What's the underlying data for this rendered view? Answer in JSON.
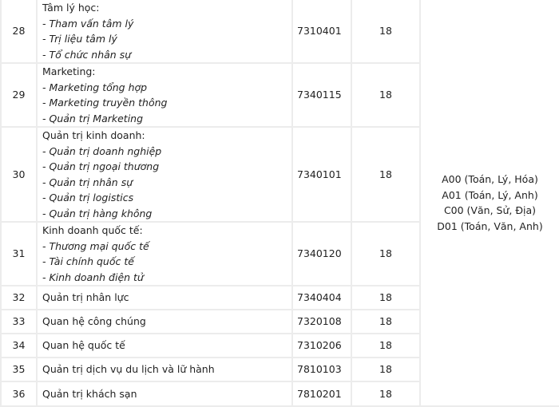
{
  "rows": [
    {
      "no": "28",
      "name": "Tâm lý học:",
      "subs": [
        "- Tham vấn tâm lý",
        "- Trị liệu tâm lý",
        "- Tổ chức nhân sự"
      ],
      "code": "7310401",
      "score": "18"
    },
    {
      "no": "29",
      "name": "Marketing:",
      "subs": [
        "- Marketing tổng hợp",
        "- Marketing truyền thông",
        "- Quản trị Marketing"
      ],
      "code": "7340115",
      "score": "18"
    },
    {
      "no": "30",
      "name": "Quản trị kinh doanh:",
      "subs": [
        "- Quản trị doanh nghiệp",
        "- Quản trị ngoại thương",
        "- Quản trị nhân sự",
        "- Quản trị logistics",
        "- Quản trị hàng không"
      ],
      "code": "7340101",
      "score": "18"
    },
    {
      "no": "31",
      "name": "Kinh doanh quốc tế:",
      "subs": [
        "- Thương mại quốc tế",
        "- Tài chính quốc tế",
        "- Kinh doanh điện tử"
      ],
      "code": "7340120",
      "score": "18"
    },
    {
      "no": "32",
      "name": "Quản trị nhân lực",
      "subs": [],
      "code": "7340404",
      "score": "18"
    },
    {
      "no": "33",
      "name": "Quan hệ công chúng",
      "subs": [],
      "code": "7320108",
      "score": "18"
    },
    {
      "no": "34",
      "name": "Quan hệ quốc tế",
      "subs": [],
      "code": "7310206",
      "score": "18"
    },
    {
      "no": "35",
      "name": "Quản trị dịch vụ du lịch và lữ hành",
      "subs": [],
      "code": "7810103",
      "score": "18"
    },
    {
      "no": "36",
      "name": "Quản trị khách sạn",
      "subs": [],
      "code": "7810201",
      "score": "18"
    }
  ],
  "combos": [
    "A00 (Toán, Lý, Hóa)",
    "A01 (Toán, Lý, Anh)",
    "C00 (Văn, Sử, Địa)",
    "D01 (Toán, Văn, Anh)"
  ]
}
